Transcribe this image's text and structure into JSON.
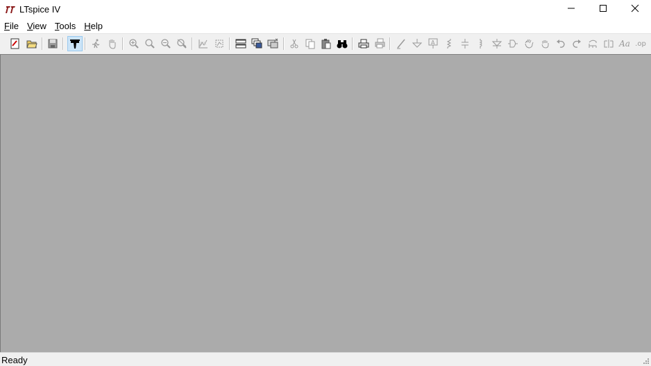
{
  "window": {
    "title": "LTspice IV",
    "controls": [
      "minimize",
      "maximize",
      "close"
    ]
  },
  "menu": {
    "items": [
      {
        "label": "File",
        "mnemonic": "F",
        "rest": "ile"
      },
      {
        "label": "View",
        "mnemonic": "V",
        "rest": "iew"
      },
      {
        "label": "Tools",
        "mnemonic": "T",
        "rest": "ools"
      },
      {
        "label": "Help",
        "mnemonic": "H",
        "rest": "elp"
      }
    ]
  },
  "toolbar": {
    "buttons": [
      "new-schematic-icon",
      "open-folder-icon",
      "save-icon",
      "control-panel-hammer-icon",
      "run-icon",
      "pan-hand-icon",
      "zoom-in-icon",
      "zoom-out-icon",
      "zoom-fit-icon",
      "zoom-cancel-icon",
      "autorange-icon",
      "autorange-y-icon",
      "tile-horizontal-icon",
      "cascade-icon",
      "close-windows-icon",
      "cut-icon",
      "copy-icon",
      "paste-icon",
      "find-icon",
      "print-icon",
      "print-preview-icon",
      "wire-icon",
      "ground-icon",
      "label-net-icon",
      "resistor-icon",
      "capacitor-icon",
      "inductor-icon",
      "diode-icon",
      "component-icon",
      "move-hand-icon",
      "drag-hand-icon",
      "undo-icon",
      "redo-icon",
      "rotate-icon",
      "mirror-icon",
      "text-icon",
      "spice-directive-icon"
    ],
    "text_button_label": "Aa",
    "directive_button_label": ".op"
  },
  "colors": {
    "workspace": "#ababab",
    "toolbar": "#f0f0f0",
    "logo": "#8b1a1a"
  },
  "status": {
    "text": "Ready"
  }
}
